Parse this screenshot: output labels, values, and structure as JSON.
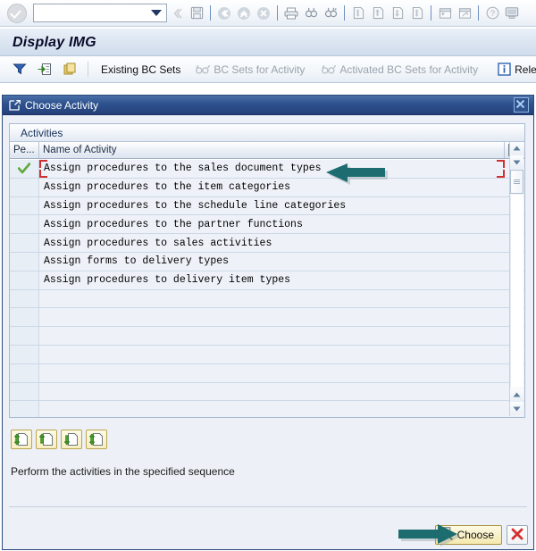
{
  "window": {
    "title": "Display IMG"
  },
  "command_bar": {
    "ok_icon": "ok-check-icon",
    "command_value": "",
    "command_placeholder": "",
    "dropdown_icon": "chevron-down-icon",
    "icons": [
      "back-icon",
      "save-icon",
      "back-arrow-icon",
      "exit-up-icon",
      "cancel-x-icon",
      "print-icon",
      "find-icon",
      "find-next-icon",
      "first-page-icon",
      "previous-page-icon",
      "next-page-icon",
      "last-page-icon",
      "new-session-icon",
      "create-shortcut-icon",
      "help-icon",
      "customize-local-layout-icon"
    ]
  },
  "app_toolbar": {
    "items": [
      {
        "label": "",
        "icon": "filter-icon",
        "enabled": true
      },
      {
        "label": "",
        "icon": "goto-entry-icon",
        "enabled": true
      },
      {
        "label": "",
        "icon": "note-icon",
        "enabled": true
      },
      {
        "label": "Existing BC Sets",
        "icon": "",
        "enabled": true
      },
      {
        "label": "BC Sets for Activity",
        "icon": "glasses-icon",
        "enabled": false
      },
      {
        "label": "Activated BC Sets for Activity",
        "icon": "glasses-icon",
        "enabled": false
      },
      {
        "label": "Release",
        "icon": "info-icon",
        "enabled": true
      }
    ]
  },
  "dialog": {
    "title": "Choose Activity",
    "title_icon": "dialog-window-icon",
    "close_icon": "close-icon",
    "tab_label": "Activities",
    "table_settings_icon": "table-settings-icon",
    "columns": [
      {
        "key": "performed",
        "label": "Pe..."
      },
      {
        "key": "name",
        "label": "Name of Activity"
      }
    ],
    "rows": [
      {
        "performed": "check",
        "name": "Assign procedures to the sales document types",
        "selected": true
      },
      {
        "performed": "",
        "name": "Assign procedures to the item categories",
        "selected": false
      },
      {
        "performed": "",
        "name": "Assign procedures to the schedule line categories",
        "selected": false
      },
      {
        "performed": "",
        "name": "Assign procedures to the partner functions",
        "selected": false
      },
      {
        "performed": "",
        "name": "Assign procedures to sales activities",
        "selected": false
      },
      {
        "performed": "",
        "name": "Assign forms to delivery types",
        "selected": false
      },
      {
        "performed": "",
        "name": "Assign procedures to delivery item types",
        "selected": false
      }
    ],
    "empty_row_count": 7,
    "scrollbar": {
      "up_icon": "scroll-up-icon",
      "down_icon": "scroll-down-icon",
      "thumb_icon": "scroll-thumb-grip",
      "page_up_icon": "scroll-page-up-icon",
      "page_down_icon": "scroll-page-down-icon"
    },
    "nav_buttons": [
      {
        "name": "first-page-button",
        "icon": "first-page-icon"
      },
      {
        "name": "previous-page-button",
        "icon": "previous-page-icon"
      },
      {
        "name": "next-page-button",
        "icon": "next-page-icon"
      },
      {
        "name": "last-page-button",
        "icon": "last-page-icon"
      }
    ],
    "hint_text": "Perform the activities in the specified sequence",
    "choose_button": {
      "label": "Choose",
      "icon": "choose-magnifier-icon"
    },
    "cancel_button": {
      "label": "",
      "icon": "cancel-red-x-icon"
    }
  },
  "annotations": [
    {
      "name": "arrow-pointing-to-selected-row",
      "color": "#1d6d70"
    },
    {
      "name": "arrow-pointing-to-choose-button",
      "color": "#1d6d70"
    }
  ],
  "colors": {
    "dialog_title_bar": "#2f5490",
    "accent_yellow_button": "#f5e9ae",
    "selection_red": "#d03030",
    "check_green": "#5faa3c",
    "annotation_teal": "#1d6d70"
  }
}
